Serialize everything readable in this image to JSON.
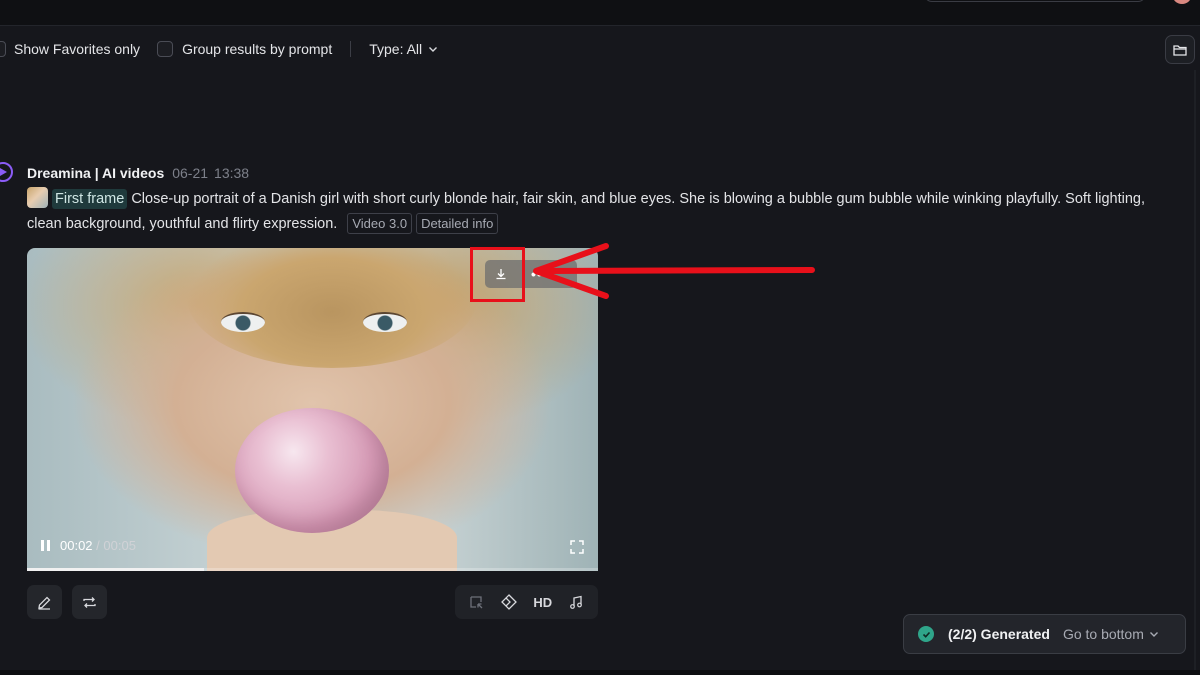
{
  "filters": {
    "favorites_label": "Show Favorites only",
    "group_label": "Group results by prompt",
    "type_label": "Type: All"
  },
  "record": {
    "author": "Dreamina | AI videos",
    "date": "06-21",
    "time": "13:38",
    "first_frame_label": "First frame",
    "prompt_text": "Close-up portrait of a Danish girl with short curly blonde hair, fair skin, and blue eyes. She is blowing a bubble gum bubble while winking playfully. Soft lighting, clean background, youthful and flirty expression.",
    "model_tag": "Video 3.0",
    "info_tag": "Detailed info"
  },
  "video": {
    "current_time": "00:02",
    "total_time": "/ 00:05",
    "progress": 0.31,
    "more_label": "•••"
  },
  "bottom_actions": {
    "hd_label": "HD"
  },
  "toast": {
    "status": "(2/2) Generated",
    "go_bottom": "Go to bottom"
  },
  "colors": {
    "background": "#16171c",
    "success": "#2fa58a",
    "annotation_red": "#e8101a",
    "logo_accent": "#8b5cf6"
  },
  "icons": [
    "folder-icon",
    "dreamina-logo-icon",
    "download-icon",
    "more-dots-icon",
    "pause-icon",
    "fullscreen-icon",
    "edit-icon",
    "regenerate-icon",
    "frame-select-icon",
    "diamond-icon",
    "music-icon",
    "check-circle-icon",
    "chevron-down-icon"
  ]
}
